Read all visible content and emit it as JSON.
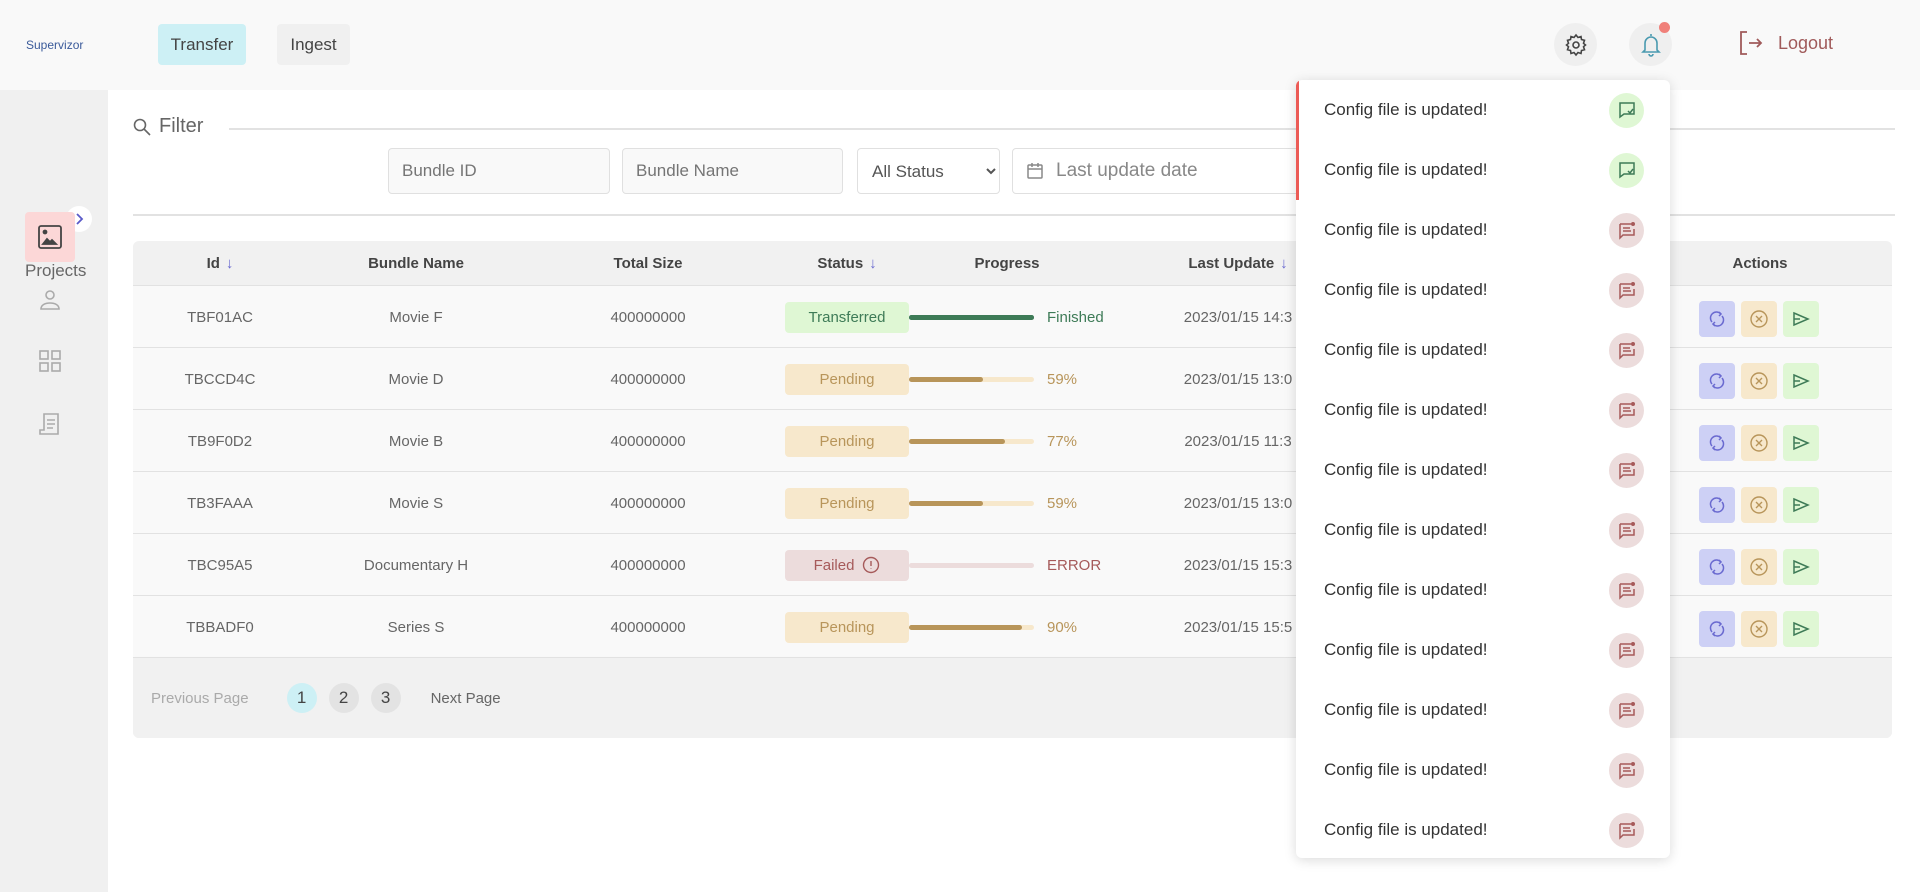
{
  "app": {
    "logo": "Supervizor"
  },
  "nav": {
    "transfer": "Transfer",
    "ingest": "Ingest",
    "logout": "Logout"
  },
  "sidebar": {
    "title": "Projects",
    "items": [
      {
        "icon": "image-icon",
        "active": true
      },
      {
        "icon": "user-icon"
      },
      {
        "icon": "grid-icon"
      },
      {
        "icon": "receipt-icon"
      }
    ]
  },
  "filter": {
    "title": "Filter",
    "bundle_id_placeholder": "Bundle ID",
    "bundle_name_placeholder": "Bundle Name",
    "status_selected": "All Status",
    "date_placeholder": "Last update date"
  },
  "table": {
    "headers": {
      "id": "Id",
      "name": "Bundle Name",
      "size": "Total Size",
      "status": "Status",
      "progress": "Progress",
      "last_update": "Last Update",
      "actions": "Actions"
    },
    "rows": [
      {
        "id": "TBF01AC",
        "name": "Movie F",
        "size": "400000000",
        "status": "Transferred",
        "progress": 100,
        "progress_label": "Finished",
        "last_update": "2023/01/15 14:3"
      },
      {
        "id": "TBCCD4C",
        "name": "Movie D",
        "size": "400000000",
        "status": "Pending",
        "progress": 59,
        "progress_label": "59%",
        "last_update": "2023/01/15 13:0"
      },
      {
        "id": "TB9F0D2",
        "name": "Movie B",
        "size": "400000000",
        "status": "Pending",
        "progress": 77,
        "progress_label": "77%",
        "last_update": "2023/01/15 11:3"
      },
      {
        "id": "TB3FAAA",
        "name": "Movie S",
        "size": "400000000",
        "status": "Pending",
        "progress": 59,
        "progress_label": "59%",
        "last_update": "2023/01/15 13:0"
      },
      {
        "id": "TBC95A5",
        "name": "Documentary H",
        "size": "400000000",
        "status": "Failed",
        "progress": 0,
        "progress_label": "ERROR",
        "last_update": "2023/01/15 15:3"
      },
      {
        "id": "TBBADF0",
        "name": "Series S",
        "size": "400000000",
        "status": "Pending",
        "progress": 90,
        "progress_label": "90%",
        "last_update": "2023/01/15 15:5"
      }
    ]
  },
  "pagination": {
    "previous": "Previous Page",
    "next": "Next Page",
    "pages": [
      "1",
      "2",
      "3"
    ],
    "current": "1"
  },
  "notifications": [
    {
      "text": "Config file is updated!",
      "read": true
    },
    {
      "text": "Config file is updated!",
      "read": true
    },
    {
      "text": "Config file is updated!",
      "read": false
    },
    {
      "text": "Config file is updated!",
      "read": false
    },
    {
      "text": "Config file is updated!",
      "read": false
    },
    {
      "text": "Config file is updated!",
      "read": false
    },
    {
      "text": "Config file is updated!",
      "read": false
    },
    {
      "text": "Config file is updated!",
      "read": false
    },
    {
      "text": "Config file is updated!",
      "read": false
    },
    {
      "text": "Config file is updated!",
      "read": false
    },
    {
      "text": "Config file is updated!",
      "read": false
    },
    {
      "text": "Config file is updated!",
      "read": false
    },
    {
      "text": "Config file is updated!",
      "read": false
    }
  ],
  "colors": {
    "Transferred": {
      "bg": "#dff7d4",
      "fg": "#3e7b57",
      "track": "#3e7b57"
    },
    "Pending": {
      "bg": "#f7e8cc",
      "fg": "#b8955a",
      "track": "#f7e8cc"
    },
    "Failed": {
      "bg": "#ecdcdc",
      "fg": "#a65a5a",
      "track": "#ecdcdc"
    }
  }
}
